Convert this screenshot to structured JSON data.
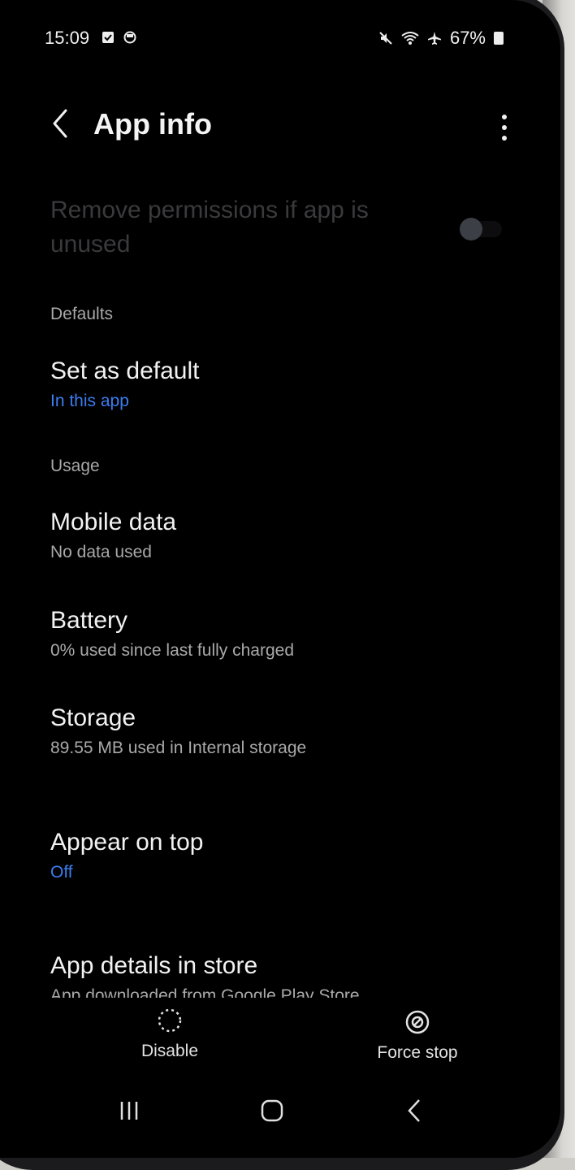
{
  "status_bar": {
    "time": "15:09",
    "battery": "67%",
    "icons": [
      "checkbox-notification-icon",
      "sync-notification-icon",
      "mute-icon",
      "wifi-icon",
      "airplane-icon",
      "battery-icon"
    ]
  },
  "header": {
    "title": "App info",
    "back_icon": "chevron-left-icon",
    "more_icon": "more-vertical-icon"
  },
  "remove_permissions": {
    "label": "Remove permissions if app is unused",
    "enabled": false
  },
  "sections": {
    "defaults": "Defaults",
    "usage": "Usage"
  },
  "items": {
    "set_default": {
      "title": "Set as default",
      "subtitle": "In this app"
    },
    "mobile_data": {
      "title": "Mobile data",
      "subtitle": "No data used"
    },
    "battery": {
      "title": "Battery",
      "subtitle": "0% used since last fully charged"
    },
    "storage": {
      "title": "Storage",
      "subtitle": "89.55 MB used in Internal storage"
    },
    "appear_on_top": {
      "title": "Appear on top",
      "subtitle": "Off"
    },
    "app_details": {
      "title": "App details in store",
      "subtitle": "App downloaded from Google Play Store"
    }
  },
  "actions": {
    "disable": "Disable",
    "force_stop": "Force stop"
  },
  "colors": {
    "accent_blue": "#3b7df0",
    "background": "#000000",
    "text_primary": "#f2f2f2",
    "text_secondary": "#a9a9a9"
  },
  "nav": [
    "recents-icon",
    "home-icon",
    "back-icon"
  ]
}
